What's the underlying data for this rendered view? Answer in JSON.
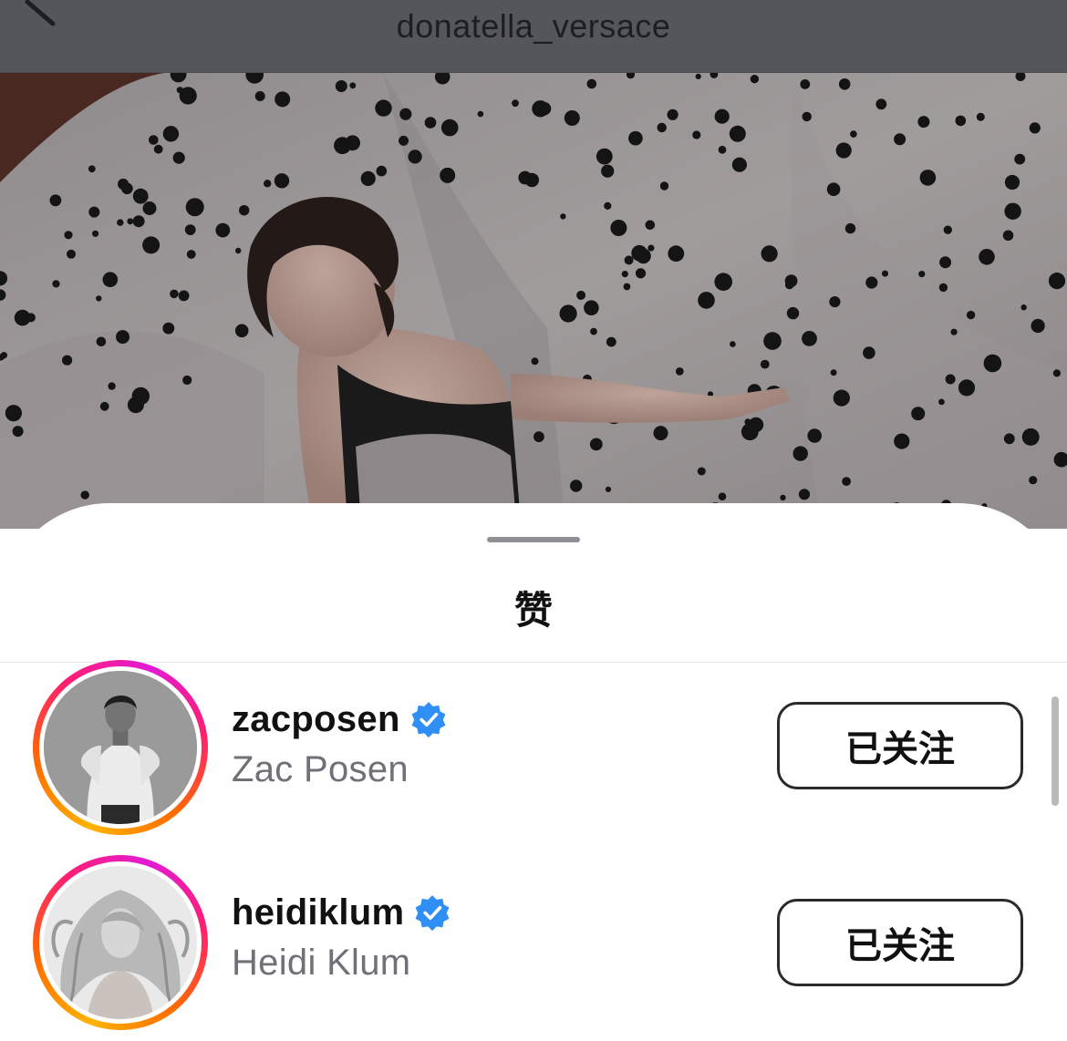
{
  "header": {
    "title": "donatella_versace",
    "back_icon": "chevron-left-icon"
  },
  "post": {
    "image_alt": "Woman lying on white fabric with black polka dots"
  },
  "sheet": {
    "title": "赞"
  },
  "likers": [
    {
      "username": "zacposen",
      "full_name": "Zac Posen",
      "verified": true,
      "follow_label": "已关注"
    },
    {
      "username": "heidiklum",
      "full_name": "Heidi Klum",
      "verified": true,
      "follow_label": "已关注"
    }
  ],
  "colors": {
    "verified_badge": "#2f8ff5",
    "story_ring_start": "#ffb300",
    "story_ring_end": "#e11bd6"
  }
}
